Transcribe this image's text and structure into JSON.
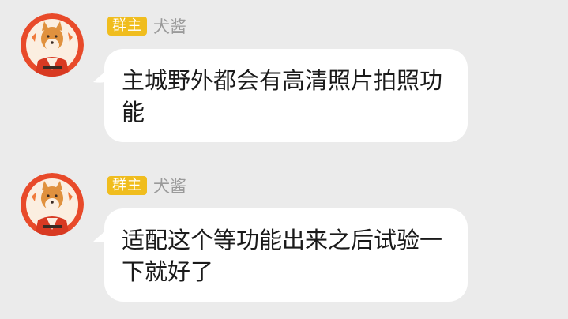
{
  "messages": [
    {
      "badge": "群主",
      "name": "犬酱",
      "text": "主城野外都会有高清照片拍照功能"
    },
    {
      "badge": "群主",
      "name": "犬酱",
      "text": "适配这个等功能出来之后试验一下就好了"
    }
  ],
  "colors": {
    "background": "#ebebeb",
    "bubble": "#ffffff",
    "badge": "#f0bd1e",
    "nickname": "#9a9a9a",
    "avatar_ring": "#e84a2a"
  },
  "icons": {
    "avatar": "shiba-dog-avatar-icon"
  }
}
